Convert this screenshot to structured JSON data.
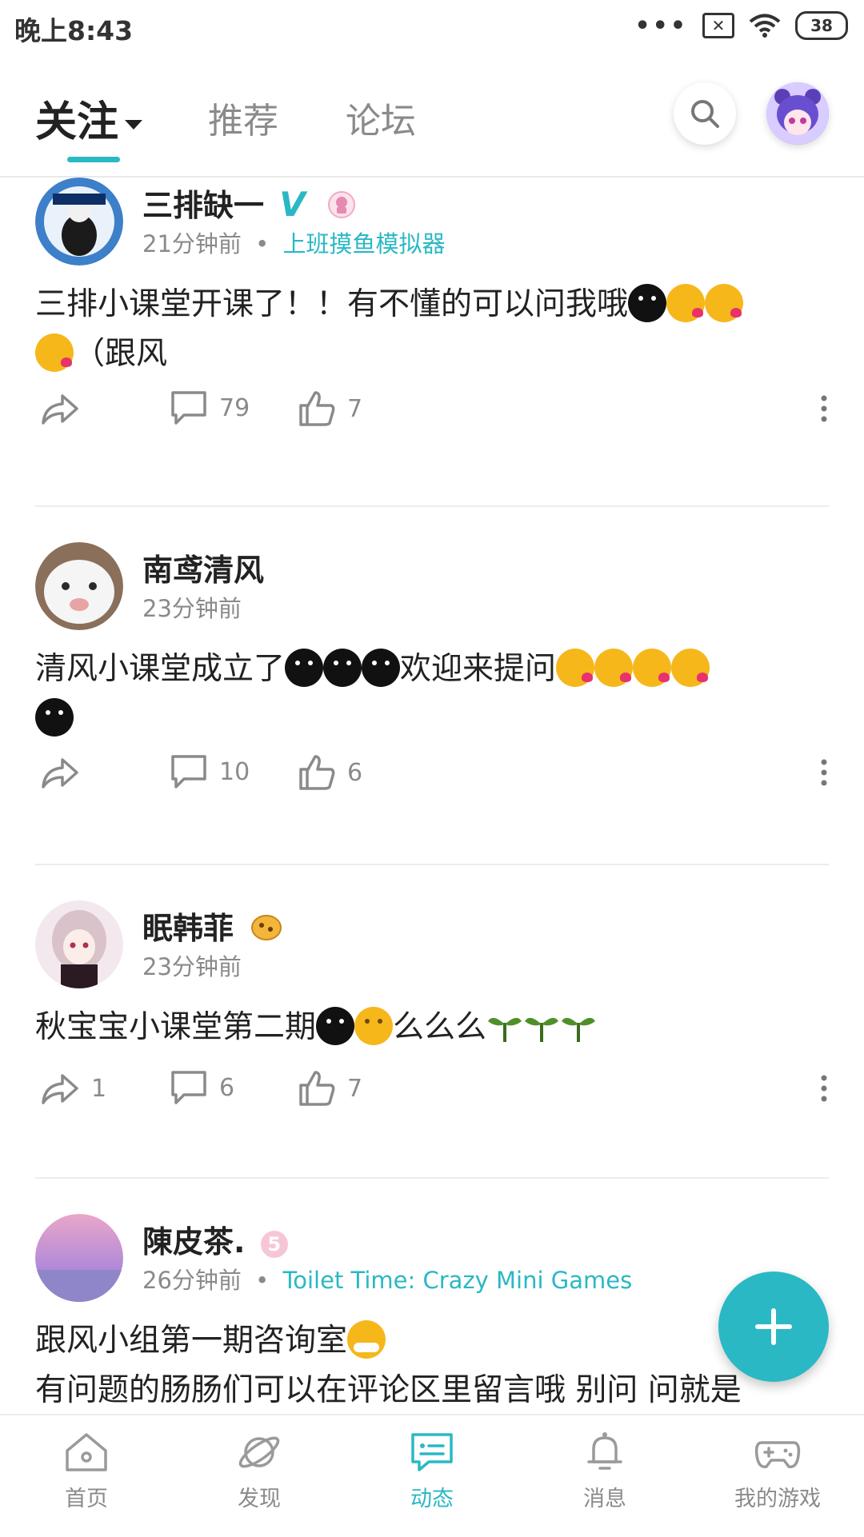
{
  "status_bar": {
    "time": "晚上8:43",
    "battery": "38",
    "dots": "•••",
    "sim": "✕"
  },
  "header": {
    "tabs": [
      {
        "label": "关注",
        "active": true
      },
      {
        "label": "推荐",
        "active": false
      },
      {
        "label": "论坛",
        "active": false
      }
    ]
  },
  "posts": [
    {
      "username": "三排缺一",
      "badge": "V",
      "time": "21分钟前",
      "game": "上班摸鱼模拟器",
      "content": "三排小课堂开课了！！有不懂的可以问我哦",
      "content_tail": "（跟风",
      "share_count": "",
      "comment_count": "79",
      "like_count": "7"
    },
    {
      "username": "南鸢清风",
      "time": "23分钟前",
      "content": "清风小课堂成立了",
      "content_mid": "欢迎来提问",
      "share_count": "",
      "comment_count": "10",
      "like_count": "6"
    },
    {
      "username": "眠韩菲",
      "time": "23分钟前",
      "content": "秋宝宝小课堂第二期",
      "content_mid": "么么么",
      "share_count": "1",
      "comment_count": "6",
      "like_count": "7"
    },
    {
      "username": "陳皮茶.",
      "badge": "5",
      "time": "26分钟前",
      "game": "Toilet Time: Crazy Mini Games",
      "content": "跟风小组第一期咨询室",
      "content_line2": "有问题的肠肠们可以在评论区里留言哦 别问 问就是"
    }
  ],
  "bottom_nav": [
    {
      "label": "首页",
      "icon": "home-icon",
      "active": false
    },
    {
      "label": "发现",
      "icon": "planet-icon",
      "active": false
    },
    {
      "label": "动态",
      "icon": "feed-icon",
      "active": true
    },
    {
      "label": "消息",
      "icon": "bell-icon",
      "active": false
    },
    {
      "label": "我的游戏",
      "icon": "gamepad-icon",
      "active": false
    }
  ],
  "colors": {
    "accent": "#2ab8c4",
    "muted": "#8a8a8a",
    "text": "#222222"
  }
}
